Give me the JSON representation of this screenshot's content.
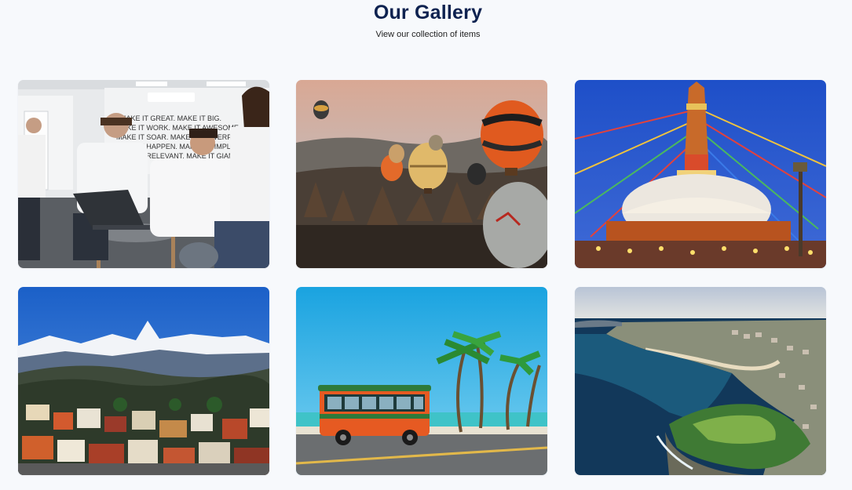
{
  "header": {
    "title": "Our Gallery",
    "subtitle": "View our collection of items"
  },
  "gallery": {
    "items": [
      {
        "subject": "team meeting around laptop in office",
        "wall_text": [
          "MAKE IT GREAT. MAKE IT BIG.",
          "MAKE IT WORK. MAKE IT AWESOME.",
          "MAKE IT SOAR. MAKE IT POWERFUL.",
          "MAKE IT HAPPEN. MAKE IT SIMPLE.",
          "MAKE IT RELEVANT. MAKE IT GIANT."
        ]
      },
      {
        "subject": "hot air balloons over rocky valley"
      },
      {
        "subject": "illuminated stupa with prayer flags at dusk"
      },
      {
        "subject": "snow-capped mountain above hillside town"
      },
      {
        "subject": "orange trolley bus on seaside road with palm trees"
      },
      {
        "subject": "aerial view of coastal bay and headland"
      }
    ]
  },
  "colors": {
    "background": "#f7f9fc",
    "title": "#0e2250"
  }
}
